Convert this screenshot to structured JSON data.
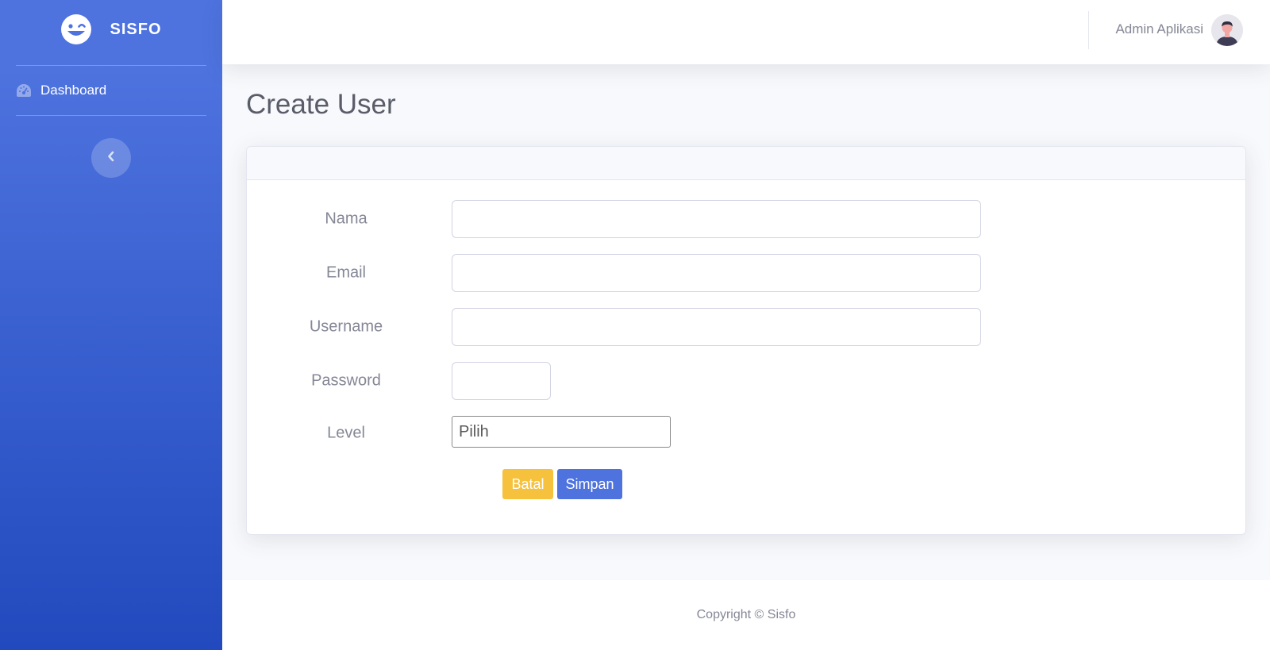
{
  "sidebar": {
    "brand_text": "SISFO",
    "brand_icon": "laugh-wink-icon",
    "items": [
      {
        "label": "Dashboard",
        "icon": "tachometer-icon"
      }
    ],
    "toggle_icon": "chevron-left-icon"
  },
  "topbar": {
    "user_name": "Admin Aplikasi",
    "avatar_icon": "user-avatar-icon"
  },
  "main": {
    "page_title": "Create User",
    "form": {
      "fields": [
        {
          "label": "Nama",
          "value": "",
          "placeholder": ""
        },
        {
          "label": "Email",
          "value": "",
          "placeholder": ""
        },
        {
          "label": "Username",
          "value": "",
          "placeholder": ""
        },
        {
          "label": "Password",
          "value": "",
          "placeholder": ""
        }
      ],
      "level": {
        "label": "Level",
        "selected": "Pilih"
      },
      "cancel_label": "Batal",
      "save_label": "Simpan"
    }
  },
  "footer": {
    "copyright": "Copyright © Sisfo"
  },
  "colors": {
    "primary": "#4e73df",
    "primary_dark": "#224abe",
    "warning": "#f6c23e",
    "text_muted": "#858796",
    "background": "#f8f9fc"
  }
}
